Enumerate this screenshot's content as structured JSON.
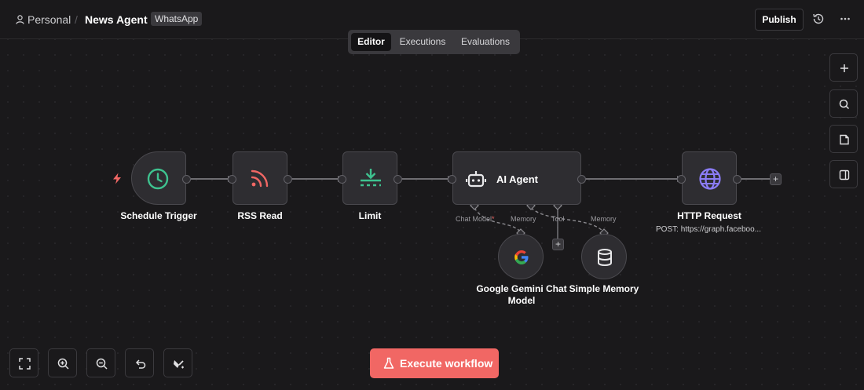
{
  "header": {
    "breadcrumb_project": "Personal",
    "breadcrumb_separator": "/",
    "workflow_title": "News Agent",
    "tag": "WhatsApp",
    "publish_label": "Publish"
  },
  "tabs": [
    {
      "label": "Editor",
      "active": true
    },
    {
      "label": "Executions",
      "active": false
    },
    {
      "label": "Evaluations",
      "active": false
    }
  ],
  "nodes": {
    "schedule_trigger": "Schedule Trigger",
    "rss_read": "RSS Read",
    "limit": "Limit",
    "ai_agent": "AI Agent",
    "http_request": "HTTP Request",
    "http_request_subtitle": "POST: https://graph.faceboo...",
    "gemini": "Google Gemini Chat Model",
    "memory": "Simple Memory"
  },
  "agent_slots": {
    "chat_model": "Chat Model",
    "chat_model_required": "*",
    "memory_slot": "Memory",
    "tool": "Tool",
    "memory": "Memory"
  },
  "execute_label": "Execute workflow",
  "colors": {
    "trigger_icon": "#3ec28f",
    "rss_icon": "#f16764",
    "limit_icon": "#3ec28f",
    "http_icon": "#8b7cf6",
    "execute_bg": "#f16764",
    "trigger_bolt": "#f16764"
  },
  "icons": {
    "side_tools": [
      "plus-icon",
      "search-icon",
      "sticky-note-icon",
      "panel-icon"
    ],
    "bottom_tools": [
      "fit-view-icon",
      "zoom-in-icon",
      "zoom-out-icon",
      "undo-icon",
      "tidy-up-icon"
    ]
  }
}
